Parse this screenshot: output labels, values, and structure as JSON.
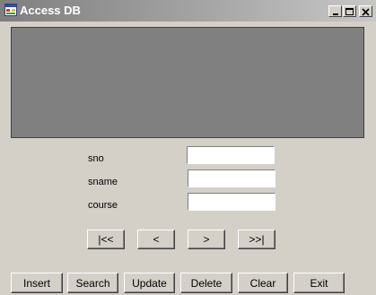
{
  "window": {
    "title": "Access DB"
  },
  "fields": [
    {
      "label": "sno",
      "value": ""
    },
    {
      "label": "sname",
      "value": ""
    },
    {
      "label": "course",
      "value": ""
    }
  ],
  "navigation": {
    "first": "|<<",
    "previous": "<",
    "next": ">",
    "last": ">>|"
  },
  "actions": {
    "insert": "Insert",
    "search": "Search",
    "update": "Update",
    "delete": "Delete",
    "clear": "Clear",
    "exit": "Exit"
  },
  "colors": {
    "window_background": "#d4d0c8",
    "grid_background": "#808080",
    "titlebar_inactive": "#7f7f7f"
  }
}
